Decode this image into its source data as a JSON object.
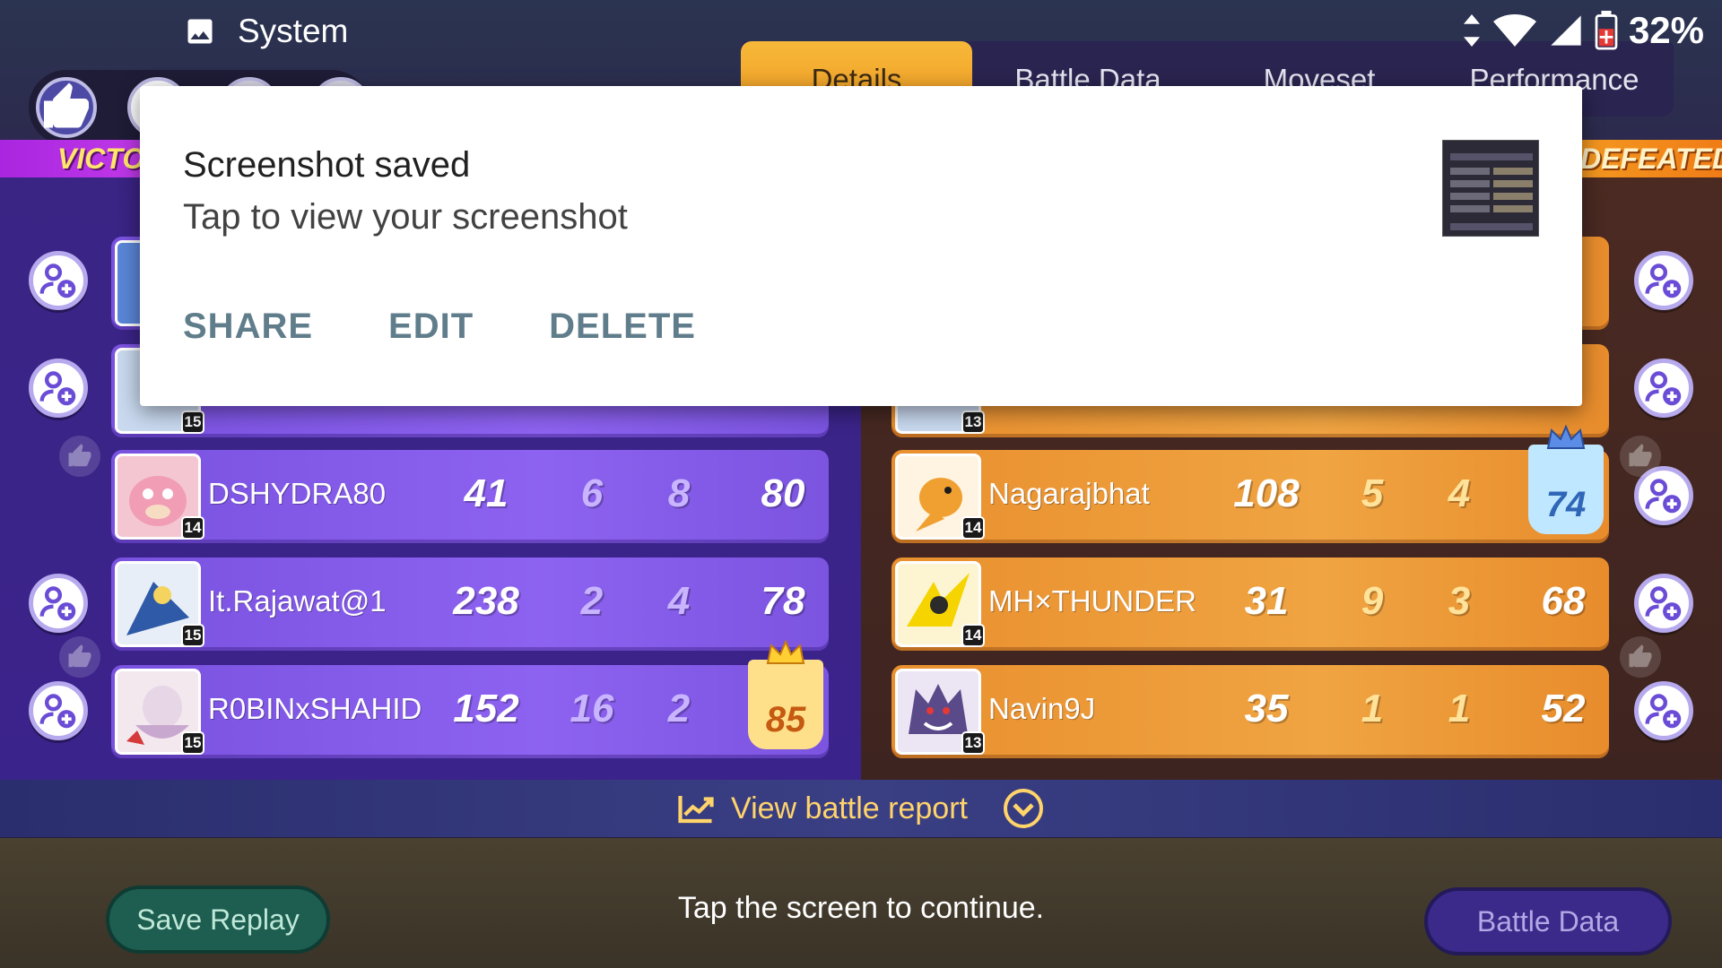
{
  "status_bar": {
    "app_label": "System",
    "battery_percent": "32%"
  },
  "tabs": [
    {
      "label": "Details",
      "active": true
    },
    {
      "label": "Battle Data",
      "active": false
    },
    {
      "label": "Moveset",
      "active": false
    },
    {
      "label": "Performance",
      "active": false
    }
  ],
  "banners": {
    "left": "VICTORY",
    "right": "DEFEATED"
  },
  "team_left": [
    {
      "name": "DSHYDRA80",
      "level": "14",
      "stat1": "41",
      "stat2": "6",
      "stat3": "8",
      "score": "80"
    },
    {
      "name": "It.Rajawat@1",
      "level": "15",
      "stat1": "238",
      "stat2": "2",
      "stat3": "4",
      "score": "78"
    },
    {
      "name": "R0BINxSHAHID",
      "level": "15",
      "stat1": "152",
      "stat2": "16",
      "stat3": "2",
      "score": "85"
    }
  ],
  "team_left_partial_level": "15",
  "team_right": [
    {
      "name": "Nagarajbhat",
      "level": "14",
      "stat1": "108",
      "stat2": "5",
      "stat3": "4",
      "score": "74"
    },
    {
      "name": "MH×THUNDER",
      "level": "14",
      "stat1": "31",
      "stat2": "9",
      "stat3": "3",
      "score": "68"
    },
    {
      "name": "Navin9J",
      "level": "13",
      "stat1": "35",
      "stat2": "1",
      "stat3": "1",
      "score": "52"
    }
  ],
  "team_right_partial_level": "13",
  "footer": {
    "report_label": "View battle report",
    "continue_text": "Tap the screen to continue.",
    "save_replay_label": "Save Replay",
    "battle_data_label": "Battle Data"
  },
  "notification": {
    "title": "Screenshot saved",
    "subtitle": "Tap to view your screenshot",
    "actions": [
      "SHARE",
      "EDIT",
      "DELETE"
    ]
  },
  "colors": {
    "purple_team": "#8d62f0",
    "orange_team": "#f0a442",
    "notif_action": "#607d8b"
  }
}
